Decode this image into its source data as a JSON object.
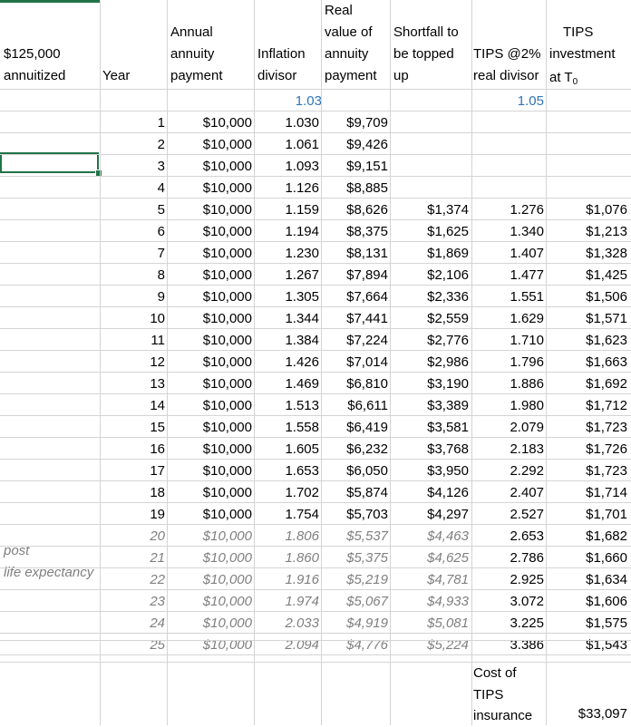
{
  "headers": {
    "principal_line1": "$125,000",
    "principal_line2": "annuitized",
    "year": "Year",
    "annual": [
      "Annual",
      "annuity",
      "payment"
    ],
    "inflation": [
      "Inflation",
      "divisor"
    ],
    "real": [
      "Real",
      "value of",
      "annuity",
      "payment"
    ],
    "shortfall": [
      "Shortfall to",
      "be topped",
      "up"
    ],
    "tips_div": [
      "TIPS @2%",
      "real divisor"
    ],
    "tips_inv_line1": "TIPS",
    "tips_inv_line2": "investment",
    "tips_inv_line3": "at T",
    "tips_inv_sub": "0"
  },
  "rates": {
    "inflation": "1.03",
    "tips": "1.05"
  },
  "notes": {
    "post": "post",
    "life_expectancy": "life expectancy"
  },
  "rows": [
    {
      "year": "1",
      "payment": "$10,000",
      "infl": "1.030",
      "real": "$9,709",
      "short": "",
      "tdiv": "",
      "tinv": ""
    },
    {
      "year": "2",
      "payment": "$10,000",
      "infl": "1.061",
      "real": "$9,426",
      "short": "",
      "tdiv": "",
      "tinv": ""
    },
    {
      "year": "3",
      "payment": "$10,000",
      "infl": "1.093",
      "real": "$9,151",
      "short": "",
      "tdiv": "",
      "tinv": ""
    },
    {
      "year": "4",
      "payment": "$10,000",
      "infl": "1.126",
      "real": "$8,885",
      "short": "",
      "tdiv": "",
      "tinv": ""
    },
    {
      "year": "5",
      "payment": "$10,000",
      "infl": "1.159",
      "real": "$8,626",
      "short": "$1,374",
      "tdiv": "1.276",
      "tinv": "$1,076"
    },
    {
      "year": "6",
      "payment": "$10,000",
      "infl": "1.194",
      "real": "$8,375",
      "short": "$1,625",
      "tdiv": "1.340",
      "tinv": "$1,213"
    },
    {
      "year": "7",
      "payment": "$10,000",
      "infl": "1.230",
      "real": "$8,131",
      "short": "$1,869",
      "tdiv": "1.407",
      "tinv": "$1,328"
    },
    {
      "year": "8",
      "payment": "$10,000",
      "infl": "1.267",
      "real": "$7,894",
      "short": "$2,106",
      "tdiv": "1.477",
      "tinv": "$1,425"
    },
    {
      "year": "9",
      "payment": "$10,000",
      "infl": "1.305",
      "real": "$7,664",
      "short": "$2,336",
      "tdiv": "1.551",
      "tinv": "$1,506"
    },
    {
      "year": "10",
      "payment": "$10,000",
      "infl": "1.344",
      "real": "$7,441",
      "short": "$2,559",
      "tdiv": "1.629",
      "tinv": "$1,571"
    },
    {
      "year": "11",
      "payment": "$10,000",
      "infl": "1.384",
      "real": "$7,224",
      "short": "$2,776",
      "tdiv": "1.710",
      "tinv": "$1,623"
    },
    {
      "year": "12",
      "payment": "$10,000",
      "infl": "1.426",
      "real": "$7,014",
      "short": "$2,986",
      "tdiv": "1.796",
      "tinv": "$1,663"
    },
    {
      "year": "13",
      "payment": "$10,000",
      "infl": "1.469",
      "real": "$6,810",
      "short": "$3,190",
      "tdiv": "1.886",
      "tinv": "$1,692"
    },
    {
      "year": "14",
      "payment": "$10,000",
      "infl": "1.513",
      "real": "$6,611",
      "short": "$3,389",
      "tdiv": "1.980",
      "tinv": "$1,712"
    },
    {
      "year": "15",
      "payment": "$10,000",
      "infl": "1.558",
      "real": "$6,419",
      "short": "$3,581",
      "tdiv": "2.079",
      "tinv": "$1,723"
    },
    {
      "year": "16",
      "payment": "$10,000",
      "infl": "1.605",
      "real": "$6,232",
      "short": "$3,768",
      "tdiv": "2.183",
      "tinv": "$1,726"
    },
    {
      "year": "17",
      "payment": "$10,000",
      "infl": "1.653",
      "real": "$6,050",
      "short": "$3,950",
      "tdiv": "2.292",
      "tinv": "$1,723"
    },
    {
      "year": "18",
      "payment": "$10,000",
      "infl": "1.702",
      "real": "$5,874",
      "short": "$4,126",
      "tdiv": "2.407",
      "tinv": "$1,714"
    },
    {
      "year": "19",
      "payment": "$10,000",
      "infl": "1.754",
      "real": "$5,703",
      "short": "$4,297",
      "tdiv": "2.527",
      "tinv": "$1,701"
    },
    {
      "year": "20",
      "payment": "$10,000",
      "infl": "1.806",
      "real": "$5,537",
      "short": "$4,463",
      "tdiv": "2.653",
      "tinv": "$1,682"
    },
    {
      "year": "21",
      "payment": "$10,000",
      "infl": "1.860",
      "real": "$5,375",
      "short": "$4,625",
      "tdiv": "2.786",
      "tinv": "$1,660"
    },
    {
      "year": "22",
      "payment": "$10,000",
      "infl": "1.916",
      "real": "$5,219",
      "short": "$4,781",
      "tdiv": "2.925",
      "tinv": "$1,634"
    },
    {
      "year": "23",
      "payment": "$10,000",
      "infl": "1.974",
      "real": "$5,067",
      "short": "$4,933",
      "tdiv": "3.072",
      "tinv": "$1,606"
    },
    {
      "year": "24",
      "payment": "$10,000",
      "infl": "2.033",
      "real": "$4,919",
      "short": "$5,081",
      "tdiv": "3.225",
      "tinv": "$1,575"
    },
    {
      "year": "25",
      "payment": "$10,000",
      "infl": "2.094",
      "real": "$4,776",
      "short": "$5,224",
      "tdiv": "3.386",
      "tinv": "$1,543"
    }
  ],
  "footer": {
    "cost_lines": [
      "Cost of",
      "TIPS",
      "insurance"
    ],
    "total": "$33,097"
  },
  "colors": {
    "grid": "#d4d4d4",
    "selection": "#217346",
    "rate_blue": "#2e75b6",
    "note_gray": "#7f7f7f"
  }
}
